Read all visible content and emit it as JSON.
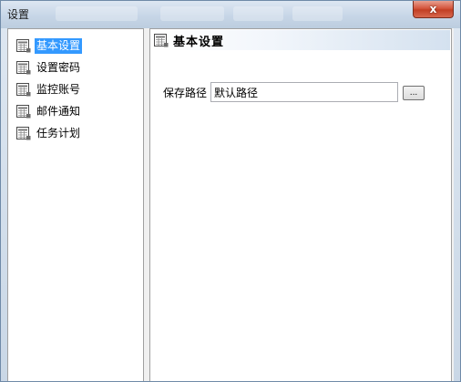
{
  "window": {
    "title": "设置",
    "close_label": "x"
  },
  "sidebar": {
    "items": [
      {
        "label": "基本设置",
        "selected": true
      },
      {
        "label": "设置密码",
        "selected": false
      },
      {
        "label": "监控账号",
        "selected": false
      },
      {
        "label": "邮件通知",
        "selected": false
      },
      {
        "label": "任务计划",
        "selected": false
      }
    ]
  },
  "main": {
    "header_title": "基本设置",
    "path_label": "保存路径",
    "path_value": "默认路径",
    "browse_label": "..."
  },
  "colors": {
    "selection": "#3399ff",
    "close_button": "#c9432a",
    "panel_border": "#a0a0a0"
  },
  "icons": {
    "node": "grid-document-icon"
  }
}
